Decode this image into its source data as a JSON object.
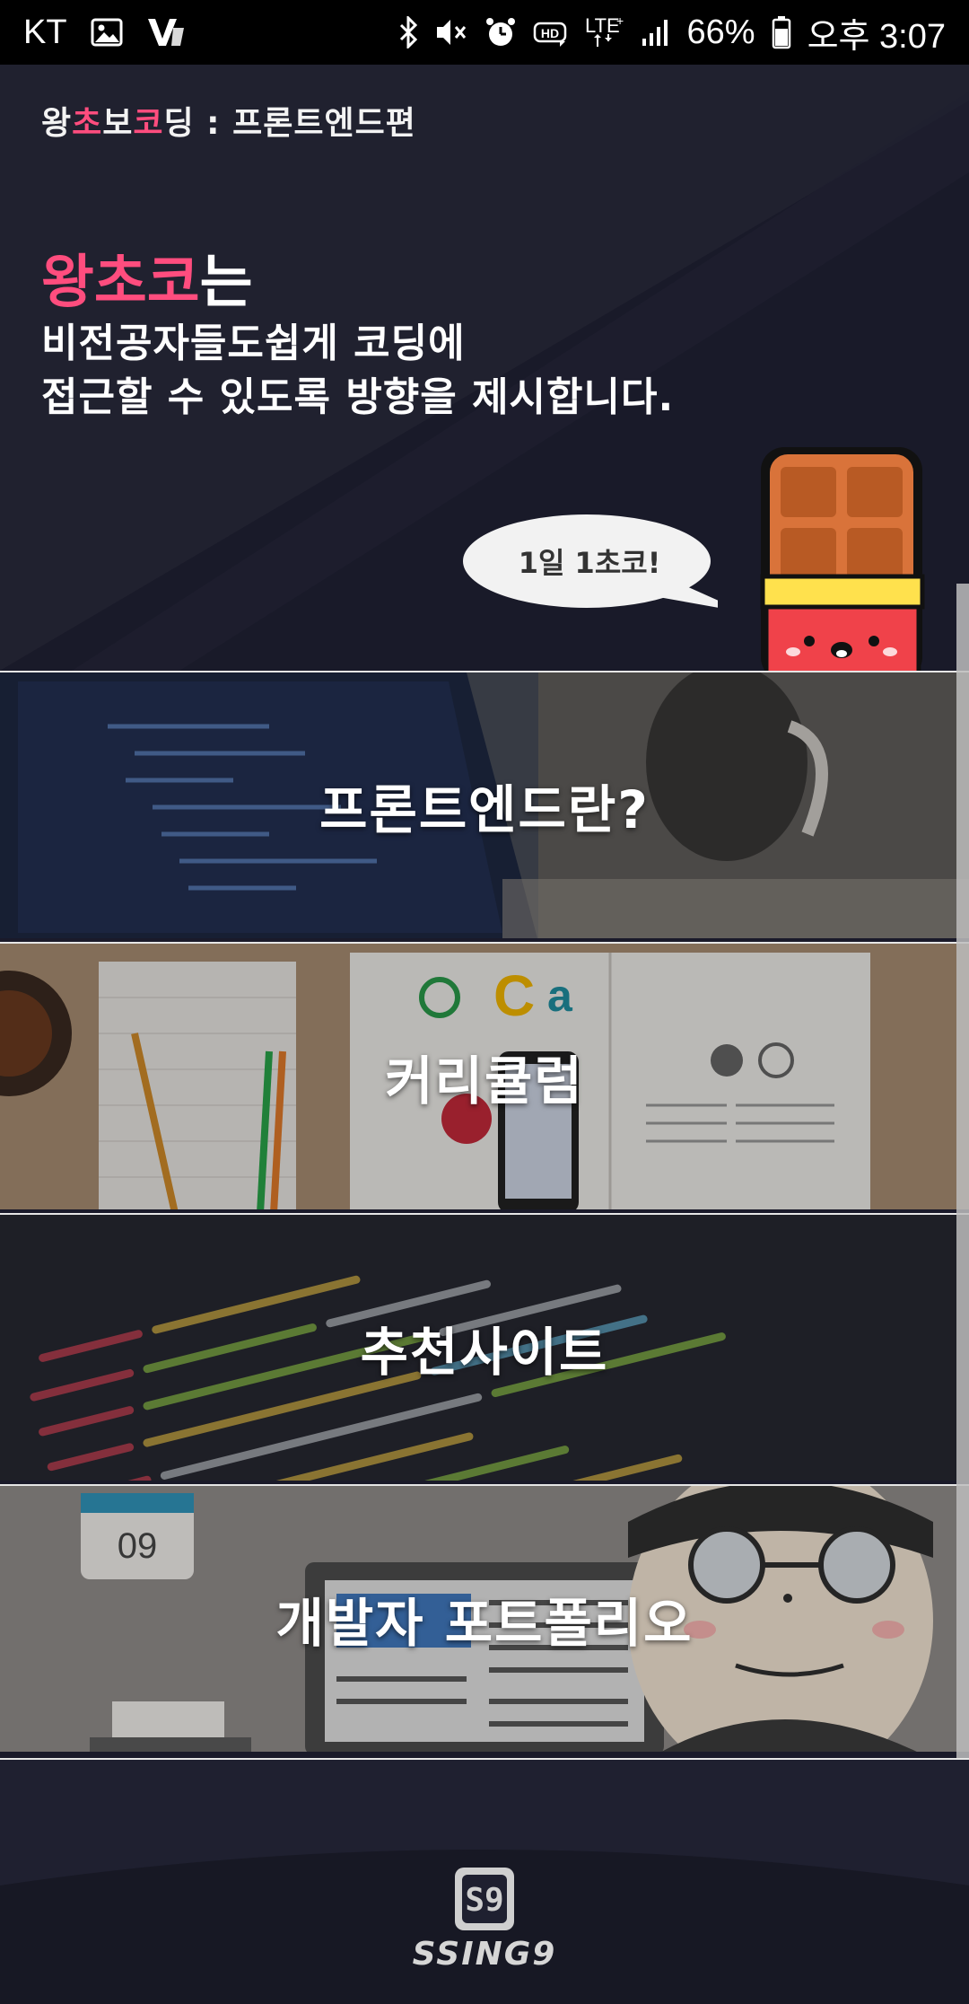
{
  "status_bar": {
    "carrier": "KT",
    "battery_percent": "66%",
    "time": "오후 3:07",
    "network": "LTE+",
    "icons": [
      "image-icon",
      "app-v-icon",
      "bluetooth-icon",
      "mute-icon",
      "alarm-icon",
      "hd-icon",
      "lte-icon",
      "signal-icon",
      "battery-icon"
    ]
  },
  "hero": {
    "small_title_parts": [
      "왕",
      "초",
      "보",
      "코",
      "딩 : 프론트엔드편"
    ],
    "brand": "왕초코",
    "brand_suffix": "는",
    "line1": "비전공자들도쉽게 코딩에",
    "line2": "접근할 수 있도록 방향을 제시합니다.",
    "speech": "1일 1초코!",
    "colors": {
      "brand_pink": "#ff4d7e",
      "background": "#1b1c2c"
    }
  },
  "menu": [
    {
      "label": "프론트엔드란?"
    },
    {
      "label": "커리큘럼"
    },
    {
      "label": "추천사이트"
    },
    {
      "label": "개발자 포트폴리오"
    }
  ],
  "footer": {
    "logo_mark": "S9",
    "logo_text": "SSING9"
  }
}
